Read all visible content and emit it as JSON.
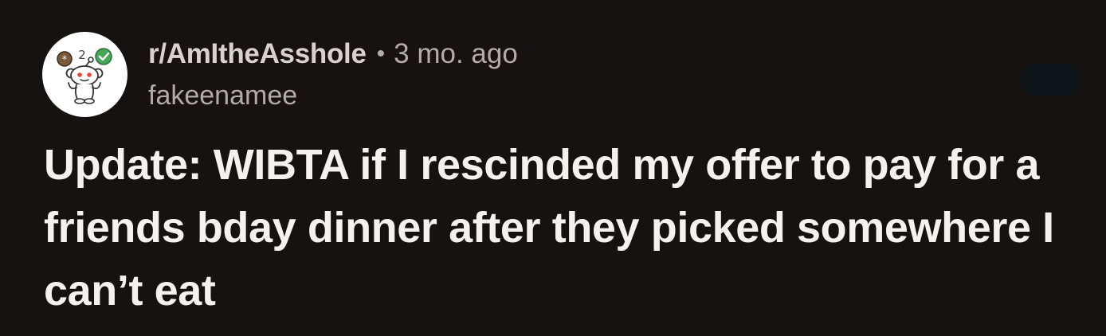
{
  "post": {
    "subreddit": "r/AmItheAsshole",
    "separator": "•",
    "time_ago": "3 mo. ago",
    "username": "fakeenamee",
    "title": "Update: WIBTA if I rescinded my offer to pay for a friends bday dinner after they picked somewhere I can’t eat"
  },
  "icons": {
    "avatar": "snoo-avatar-icon",
    "menu": "more-options-button"
  },
  "colors": {
    "background": "#151211",
    "title_text": "#f4f1ee",
    "subreddit_text": "#d8d2cc",
    "meta_text": "#b3aca6",
    "avatar_bg": "#ffffff",
    "badge_green": "#46a758",
    "badge_brown": "#7a5a3c",
    "snoo_eye_red": "#e8463a"
  }
}
